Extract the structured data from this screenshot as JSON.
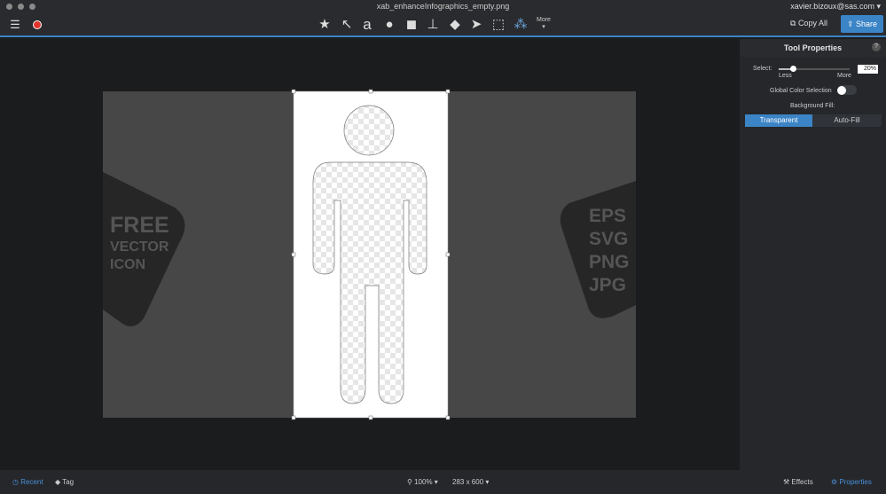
{
  "window": {
    "title": "xab_enhanceInfographics_empty.png",
    "user": "xavier.bizoux@sas.com ▾"
  },
  "toolbar": {
    "tools": [
      "star",
      "arrow",
      "text",
      "speech-bubble",
      "shapes",
      "stamp",
      "fill",
      "selection-arrow",
      "rect-select",
      "magic-wand"
    ],
    "more_label": "More",
    "copy_all": "Copy All",
    "share": "Share"
  },
  "image": {
    "left_badge": [
      "FREE",
      "VECTOR",
      "ICON"
    ],
    "right_badge": [
      "EPS",
      "SVG",
      "PNG",
      "JPG"
    ]
  },
  "panel": {
    "title": "Tool Properties",
    "help": "?",
    "select_label": "Select:",
    "less": "Less",
    "more": "More",
    "select_value": "20%",
    "select_fraction": 0.2,
    "global_color": "Global Color Selection",
    "background_fill": "Background Fill:",
    "fill_options": [
      "Transparent",
      "Auto-Fill"
    ],
    "fill_selected": "Transparent"
  },
  "bottom": {
    "recent": "Recent",
    "tag": "Tag",
    "zoom": "100% ▾",
    "size": "283 x 600 ▾",
    "effects": "Effects",
    "properties": "Properties"
  },
  "colors": {
    "accent": "#3b84c6",
    "record": "#e0332b"
  }
}
